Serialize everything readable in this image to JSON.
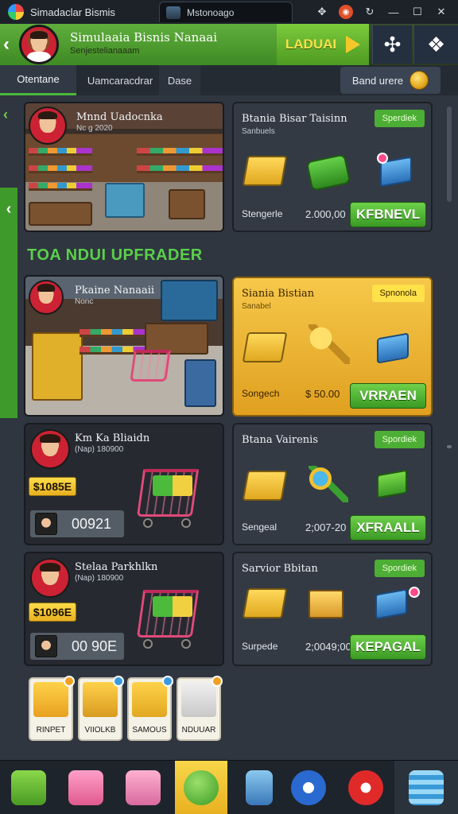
{
  "window": {
    "app_title": "Simadaclar Bismis",
    "tab_title": "Mstonoago",
    "colors": {
      "accent": "#4cae34",
      "gold": "#f6c84a",
      "background": "#2f3640"
    }
  },
  "header": {
    "title": "Simulaaia Bisnis Nanaai",
    "subtitle": "Senjestelianaaam",
    "lead_button": "LADUAI"
  },
  "tabs": [
    {
      "label": "Otentane"
    },
    {
      "label": "Uamcaracdrar"
    },
    {
      "label": "Dase"
    }
  ],
  "bank_button": "Band urere",
  "section_title": "TOA NDUI UPFRADER",
  "stores": [
    {
      "name": "Mnnd Uadocnka",
      "meta": "Nc g 2020"
    },
    {
      "name": "Pkaine Nanaaii",
      "meta": "Nonc"
    },
    {
      "name": "Km Ka Bliaidn",
      "meta": "(Nap) 180900",
      "price": "$1085E",
      "stat": "00921"
    },
    {
      "name": "Stelaa Parkhlkn",
      "meta": "(Nap) 180900",
      "price": "$1096E",
      "stat": "00 90E"
    }
  ],
  "upgrades": [
    {
      "title": "Btania Bisar Taisinn",
      "sub": "Sanbuels",
      "badge": "Sperdiek",
      "left": "Stengerle",
      "price": "2.000,00",
      "button": "KFBNEVL"
    },
    {
      "title": "Siania Bistian",
      "sub": "Sanabel",
      "badge": "Spnonola",
      "left": "Songech",
      "price": "$ 50.00",
      "button": "VRRAEN"
    },
    {
      "title": "Btana Vairenis",
      "sub": "",
      "badge": "Spordiek",
      "left": "Sengeal",
      "price": "2;007-20",
      "button": "XFRAALL"
    },
    {
      "title": "Sarvior Bbitan",
      "sub": "",
      "badge": "Spordiek",
      "left": "Surpede",
      "price": "2;0049;00",
      "button": "KEPAGAL"
    }
  ],
  "categories": [
    {
      "label": "RINPET"
    },
    {
      "label": "VIIOLKB"
    },
    {
      "label": "SAMOUS"
    },
    {
      "label": "NDUUAR"
    }
  ],
  "nav": [
    "gift-box-icon",
    "pink-gift-icon",
    "toy-box-icon",
    "chat-icon",
    "bottle-icon",
    "tool-icon",
    "tv-icon",
    "list-icon"
  ]
}
